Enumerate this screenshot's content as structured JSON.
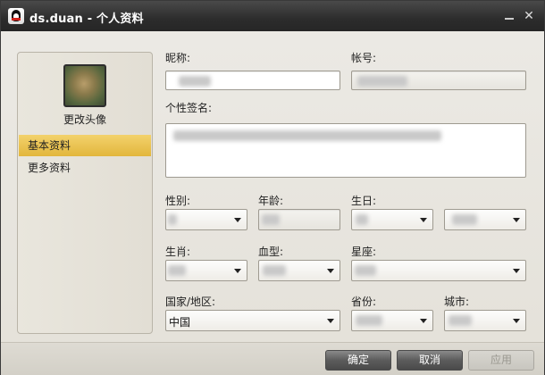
{
  "window": {
    "title": "ds.duan - 个人资料",
    "minimize_glyph": "",
    "close_glyph": "✕",
    "icon": "qq-penguin-icon"
  },
  "sidebar": {
    "avatar_label": "更改头像",
    "items": [
      {
        "label": "基本资料",
        "active": true
      },
      {
        "label": "更多资料",
        "active": false
      }
    ]
  },
  "form": {
    "nickname_label": "昵称:",
    "account_label": "帐号:",
    "signature_label": "个性签名:",
    "gender_label": "性别:",
    "age_label": "年龄:",
    "birthday_label": "生日:",
    "zodiac_animal_label": "生肖:",
    "blood_type_label": "血型:",
    "constellation_label": "星座:",
    "country_label": "国家/地区:",
    "province_label": "省份:",
    "city_label": "城市:",
    "country_value": "中国"
  },
  "buttons": {
    "ok": "确定",
    "cancel": "取消",
    "apply": "应用"
  },
  "colors": {
    "active_item": "#e8be47",
    "titlebar": "#2c2c2c"
  }
}
